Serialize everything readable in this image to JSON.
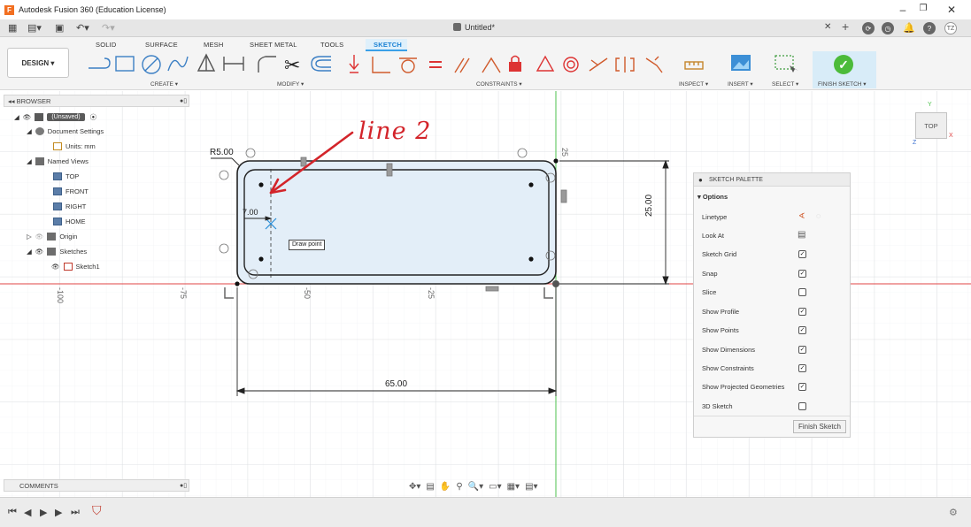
{
  "window": {
    "title": "Autodesk Fusion 360 (Education License)",
    "document_title": "Untitled*",
    "user_initials": "TZ"
  },
  "ribbon": {
    "design_label": "DESIGN ▾",
    "tabs": [
      "SOLID",
      "SURFACE",
      "MESH",
      "SHEET METAL",
      "TOOLS",
      "SKETCH"
    ],
    "groups": {
      "create": "CREATE ▾",
      "modify": "MODIFY ▾",
      "constraints": "CONSTRAINTS ▾",
      "inspect": "INSPECT ▾",
      "insert": "INSERT ▾",
      "select": "SELECT ▾",
      "finish": "FINISH SKETCH ▾"
    }
  },
  "browser": {
    "header": "BROWSER",
    "items": [
      {
        "label": "(Unsaved)"
      },
      {
        "label": "Document Settings"
      },
      {
        "label": "Units: mm"
      },
      {
        "label": "Named Views"
      },
      {
        "label": "TOP"
      },
      {
        "label": "FRONT"
      },
      {
        "label": "RIGHT"
      },
      {
        "label": "HOME"
      },
      {
        "label": "Origin"
      },
      {
        "label": "Sketches"
      },
      {
        "label": "Sketch1"
      }
    ]
  },
  "comments": {
    "header": "COMMENTS"
  },
  "sketch_palette": {
    "header": "SKETCH PALETTE",
    "section": "▾ Options",
    "rows": [
      {
        "label": "Linetype",
        "checked": null
      },
      {
        "label": "Look At",
        "checked": null
      },
      {
        "label": "Sketch Grid",
        "checked": true
      },
      {
        "label": "Snap",
        "checked": true
      },
      {
        "label": "Slice",
        "checked": false
      },
      {
        "label": "Show Profile",
        "checked": true
      },
      {
        "label": "Show Points",
        "checked": true
      },
      {
        "label": "Show Dimensions",
        "checked": true
      },
      {
        "label": "Show Constraints",
        "checked": true
      },
      {
        "label": "Show Projected Geometries",
        "checked": true
      },
      {
        "label": "3D Sketch",
        "checked": false
      }
    ],
    "finish_button": "Finish Sketch"
  },
  "sketch": {
    "dim_radius": "R5.00",
    "dim_offset": "7.00",
    "dim_height": "25.00",
    "dim_width": "65.00",
    "axis_labels": {
      "minus100": "-100",
      "minus75": "-75",
      "minus50": "-50",
      "minus25": "-25",
      "plus25": "25"
    },
    "tooltip": "Draw point"
  },
  "annotation": {
    "text": "line 2",
    "color": "#d3242a"
  },
  "viewcube": {
    "label": "TOP",
    "axis_y": "Y",
    "axis_x": "X",
    "axis_z": "Z"
  },
  "colors": {
    "accent": "#1c82d4",
    "sketch_fill": "#e3eef8",
    "x_axis": "#e04545",
    "y_axis": "#4cc24c",
    "finish_green": "#4cbb3a"
  }
}
